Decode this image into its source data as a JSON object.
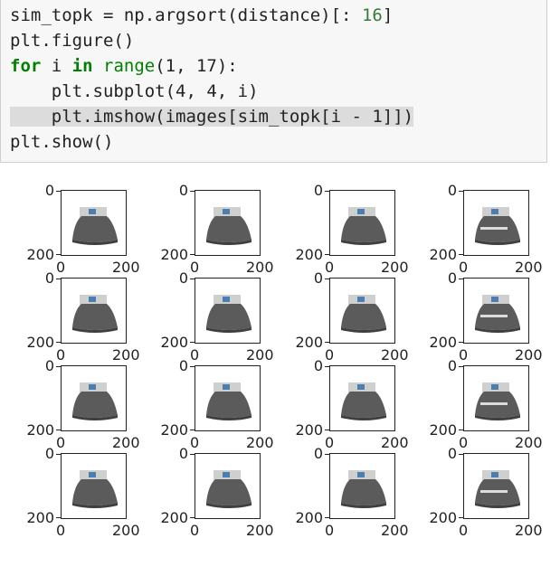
{
  "code": {
    "lines": [
      [
        "sim_topk = np.argsort(distance)[: ",
        "16",
        "]"
      ],
      [
        "plt.figure()"
      ],
      [
        "for",
        " i ",
        "in",
        " ",
        "range",
        "(1, 17):"
      ],
      [
        "    plt.subplot(4, 4, i)"
      ],
      [
        "    plt.imshow(images[sim_topk[i - 1]])"
      ],
      [
        "plt.show()"
      ]
    ]
  },
  "figure": {
    "ytick_labels": [
      "0",
      "200"
    ],
    "xtick_labels": [
      "0",
      "200"
    ],
    "subplot_count": 16,
    "image_description": "bed thumbnail"
  },
  "colors": {
    "keyword": "#008000",
    "number": "#3a7a3a",
    "cell_bg": "#f7f7f7",
    "highlight": "#dcdcdc"
  }
}
